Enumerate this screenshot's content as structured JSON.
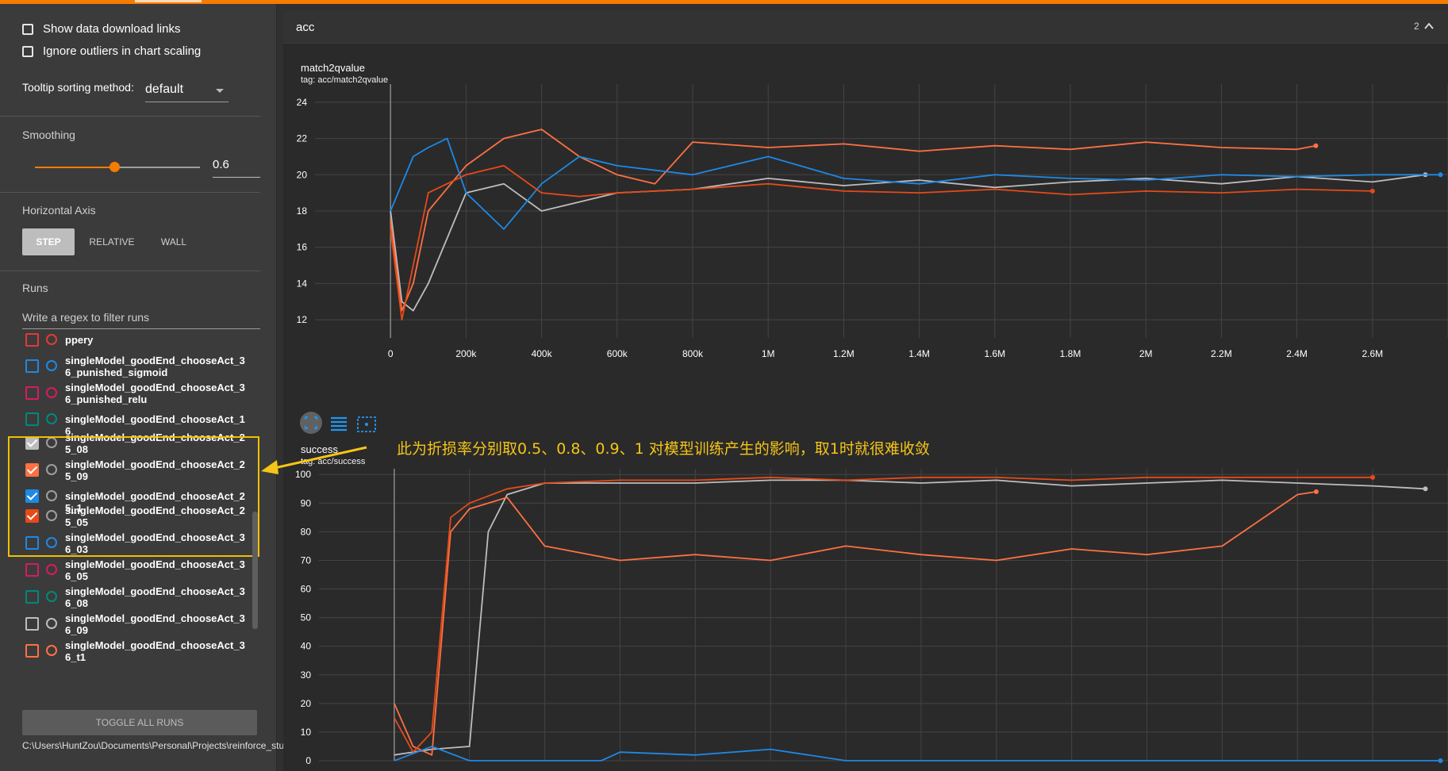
{
  "options": {
    "show_download_links": "Show data download links",
    "ignore_outliers": "Ignore outliers in chart scaling",
    "tooltip_label": "Tooltip sorting method:",
    "tooltip_value": "default"
  },
  "smoothing": {
    "label": "Smoothing",
    "value": "0.6",
    "fraction": 0.6
  },
  "horizontal_axis": {
    "label": "Horizontal Axis",
    "buttons": [
      "STEP",
      "RELATIVE",
      "WALL"
    ],
    "active": "STEP"
  },
  "runs": {
    "label": "Runs",
    "filter_placeholder": "Write a regex to filter runs",
    "items": [
      {
        "name": "ppery",
        "color": "#e53935",
        "checked": false
      },
      {
        "name": "singleModel_goodEnd_chooseAct_36_punished_sigmoid",
        "color": "#1e88e5",
        "checked": false
      },
      {
        "name": "singleModel_goodEnd_chooseAct_36_punished_relu",
        "color": "#d81b60",
        "checked": false
      },
      {
        "name": "singleModel_goodEnd_chooseAct_16",
        "color": "#00897b",
        "checked": false
      },
      {
        "name": "singleModel_goodEnd_chooseAct_25_08",
        "color": "#bdbdbd",
        "checked": true
      },
      {
        "name": "singleModel_goodEnd_chooseAct_25_09",
        "color": "#ff7043",
        "checked": true
      },
      {
        "name": "singleModel_goodEnd_chooseAct_25_1",
        "color": "#1e88e5",
        "checked": true
      },
      {
        "name": "singleModel_goodEnd_chooseAct_25_05",
        "color": "#e64a19",
        "checked": true
      },
      {
        "name": "singleModel_goodEnd_chooseAct_36_03",
        "color": "#1e88e5",
        "checked": false
      },
      {
        "name": "singleModel_goodEnd_chooseAct_36_05",
        "color": "#d81b60",
        "checked": false
      },
      {
        "name": "singleModel_goodEnd_chooseAct_36_08",
        "color": "#00897b",
        "checked": false
      },
      {
        "name": "singleModel_goodEnd_chooseAct_36_09",
        "color": "#bdbdbd",
        "checked": false
      },
      {
        "name": "singleModel_goodEnd_chooseAct_36_t1",
        "color": "#ff7043",
        "checked": false
      }
    ],
    "toggle_all": "TOGGLE ALL RUNS",
    "log_path": "C:\\Users\\HuntZou\\Documents\\Personal\\Projects\\reinforce_study\\log"
  },
  "group": {
    "name": "acc",
    "count": "2"
  },
  "annotation": "此为折损率分别取0.5、0.8、0.9、1 对模型训练产生的影响，取1时就很难收敛",
  "colors": {
    "accent": "#f57c00",
    "run_25_08": "#bdbdbd",
    "run_25_09": "#ff7043",
    "run_25_1": "#1e88e5",
    "run_25_05": "#e64a19",
    "highlight": "#f0c000"
  },
  "icons": {
    "fit_domain": "fit-domain-icon",
    "log_scale": "lines-icon",
    "select_zoom": "select-region-icon",
    "collapse": "chevron-up-icon"
  },
  "chart_data": [
    {
      "type": "line",
      "title": "match2qvalue",
      "tag": "tag: acc/match2qvalue",
      "x_ticks": [
        "0",
        "200k",
        "400k",
        "600k",
        "800k",
        "1M",
        "1.2M",
        "1.4M",
        "1.6M",
        "1.8M",
        "2M",
        "2.2M",
        "2.4M",
        "2.6M"
      ],
      "y_ticks": [
        "12",
        "14",
        "16",
        "18",
        "20",
        "22",
        "24"
      ],
      "xlim": [
        -200000,
        2800000
      ],
      "ylim": [
        11,
        25
      ],
      "series": [
        {
          "name": "singleModel_goodEnd_chooseAct_25_08",
          "color": "#bdbdbd",
          "x": [
            0,
            30000,
            60000,
            100000,
            200000,
            300000,
            400000,
            500000,
            600000,
            800000,
            1000000,
            1200000,
            1400000,
            1600000,
            1800000,
            2000000,
            2200000,
            2400000,
            2600000,
            2740000
          ],
          "y": [
            18,
            13,
            12.5,
            14,
            19,
            19.5,
            18,
            18.5,
            19,
            19.2,
            19.8,
            19.4,
            19.7,
            19.3,
            19.6,
            19.8,
            19.5,
            19.9,
            19.6,
            20
          ]
        },
        {
          "name": "singleModel_goodEnd_chooseAct_25_09",
          "color": "#ff7043",
          "x": [
            0,
            30000,
            60000,
            100000,
            200000,
            300000,
            400000,
            500000,
            600000,
            700000,
            800000,
            1000000,
            1200000,
            1400000,
            1600000,
            1800000,
            2000000,
            2200000,
            2400000,
            2450000
          ],
          "y": [
            17.5,
            12.5,
            14,
            18,
            20.5,
            22,
            22.5,
            21,
            20,
            19.5,
            21.8,
            21.5,
            21.7,
            21.3,
            21.6,
            21.4,
            21.8,
            21.5,
            21.4,
            21.6
          ]
        },
        {
          "name": "singleModel_goodEnd_chooseAct_25_1",
          "color": "#1e88e5",
          "x": [
            0,
            30000,
            60000,
            100000,
            150000,
            200000,
            300000,
            400000,
            500000,
            600000,
            800000,
            1000000,
            1200000,
            1400000,
            1600000,
            1800000,
            2000000,
            2200000,
            2400000,
            2600000,
            2780000
          ],
          "y": [
            18,
            19.5,
            21,
            21.5,
            22,
            19,
            17,
            19.5,
            21,
            20.5,
            20,
            21,
            19.8,
            19.5,
            20,
            19.8,
            19.7,
            20,
            19.9,
            20,
            20
          ]
        },
        {
          "name": "singleModel_goodEnd_chooseAct_25_05",
          "color": "#e64a19",
          "x": [
            0,
            30000,
            60000,
            100000,
            200000,
            300000,
            400000,
            500000,
            600000,
            800000,
            1000000,
            1200000,
            1400000,
            1600000,
            1800000,
            2000000,
            2200000,
            2400000,
            2600000
          ],
          "y": [
            17,
            12,
            15,
            19,
            20,
            20.5,
            19,
            18.8,
            19,
            19.2,
            19.5,
            19.1,
            19,
            19.2,
            18.9,
            19.1,
            19,
            19.2,
            19.1
          ]
        }
      ]
    },
    {
      "type": "line",
      "title": "success",
      "tag": "tag: acc/success",
      "x_ticks": [],
      "y_ticks": [
        "0",
        "10",
        "20",
        "30",
        "40",
        "50",
        "60",
        "70",
        "80",
        "90",
        "100"
      ],
      "xlim": [
        -200000,
        2800000
      ],
      "ylim": [
        0,
        102
      ],
      "series": [
        {
          "name": "singleModel_goodEnd_chooseAct_25_08",
          "color": "#bdbdbd",
          "x": [
            0,
            50000,
            100000,
            200000,
            250000,
            300000,
            400000,
            600000,
            800000,
            1000000,
            1200000,
            1400000,
            1600000,
            1800000,
            2000000,
            2200000,
            2400000,
            2600000,
            2740000
          ],
          "y": [
            2,
            3,
            4,
            5,
            80,
            93,
            97,
            97,
            97,
            98,
            98,
            97,
            98,
            96,
            97,
            98,
            97,
            96,
            95
          ]
        },
        {
          "name": "singleModel_goodEnd_chooseAct_25_09",
          "color": "#ff7043",
          "x": [
            0,
            50000,
            100000,
            150000,
            200000,
            300000,
            400000,
            600000,
            800000,
            1000000,
            1200000,
            1400000,
            1600000,
            1800000,
            2000000,
            2200000,
            2400000,
            2450000
          ],
          "y": [
            20,
            5,
            2,
            80,
            88,
            92,
            75,
            70,
            72,
            70,
            75,
            72,
            70,
            74,
            72,
            75,
            93,
            94
          ]
        },
        {
          "name": "singleModel_goodEnd_chooseAct_25_1",
          "color": "#1e88e5",
          "x": [
            0,
            100000,
            200000,
            400000,
            550000,
            600000,
            800000,
            1000000,
            1200000,
            1400000,
            1600000,
            1800000,
            2000000,
            2200000,
            2400000,
            2600000,
            2780000
          ],
          "y": [
            0,
            5,
            0,
            0,
            0,
            3,
            2,
            4,
            0,
            0,
            0,
            0,
            0,
            0,
            0,
            0,
            0
          ]
        },
        {
          "name": "singleModel_goodEnd_chooseAct_25_05",
          "color": "#e64a19",
          "x": [
            0,
            50000,
            100000,
            150000,
            200000,
            300000,
            400000,
            600000,
            800000,
            1000000,
            1200000,
            1400000,
            1600000,
            1800000,
            2000000,
            2200000,
            2400000,
            2600000
          ],
          "y": [
            15,
            3,
            10,
            85,
            90,
            95,
            97,
            98,
            98,
            99,
            98,
            99,
            99,
            98,
            99,
            99,
            99,
            99
          ]
        }
      ]
    }
  ]
}
